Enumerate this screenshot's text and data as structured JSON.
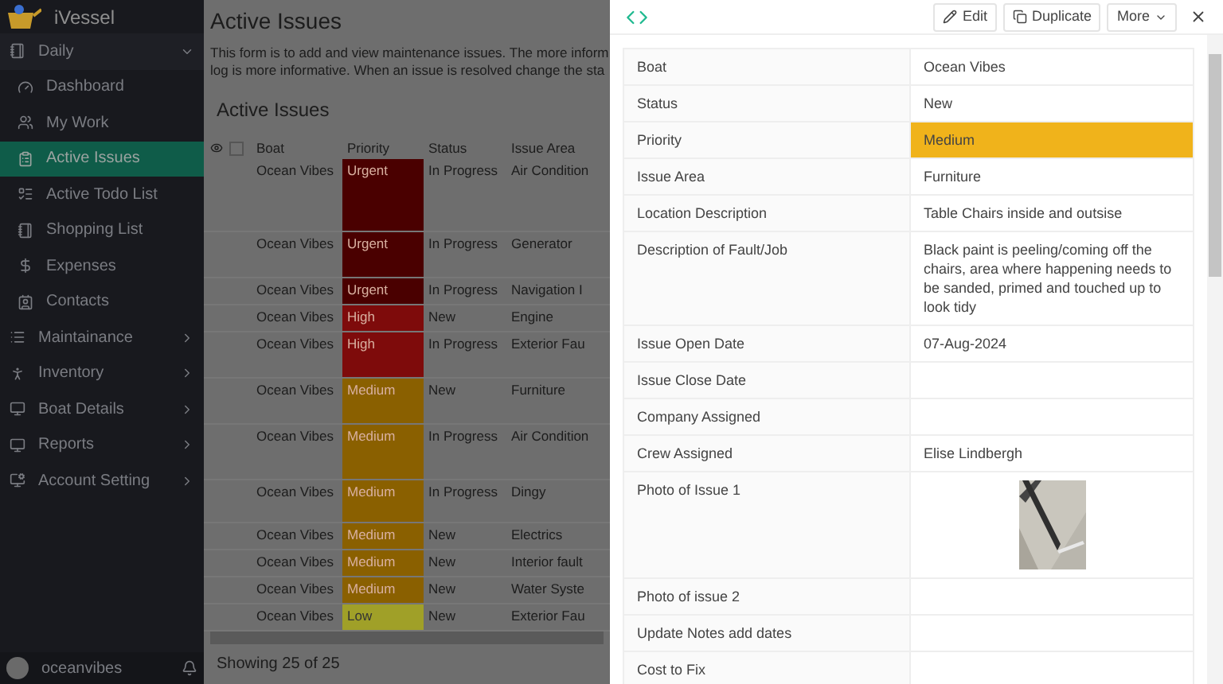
{
  "app": {
    "name": "iVessel"
  },
  "sidebar": {
    "groups": [
      {
        "label": "Daily",
        "expanded": true,
        "children": [
          {
            "label": "Dashboard",
            "selected": false
          },
          {
            "label": "My Work",
            "selected": false
          },
          {
            "label": "Active Issues",
            "selected": true
          },
          {
            "label": "Active Todo List",
            "selected": false
          },
          {
            "label": "Shopping List",
            "selected": false
          },
          {
            "label": "Expenses",
            "selected": false
          },
          {
            "label": "Contacts",
            "selected": false
          }
        ]
      },
      {
        "label": "Maintainance",
        "expanded": false
      },
      {
        "label": "Inventory",
        "expanded": false
      },
      {
        "label": "Boat Details",
        "expanded": false
      },
      {
        "label": "Reports",
        "expanded": false
      },
      {
        "label": "Account Setting",
        "expanded": false
      }
    ],
    "user": "oceanvibes"
  },
  "page": {
    "title": "Active Issues",
    "description": [
      "This form is to add and view maintenance issues. The more inform",
      "log is more informative. When an issue is resolved change the sta"
    ],
    "section_title": "Active Issues"
  },
  "table": {
    "columns": [
      "Boat",
      "Priority",
      "Status",
      "Issue Area"
    ],
    "rows": [
      {
        "boat": "Ocean Vibes",
        "priority": "Urgent",
        "color": "#4a0000",
        "status": "In Progress",
        "area": "Air Condition"
      },
      {
        "boat": "Ocean Vibes",
        "priority": "Urgent",
        "color": "#4a0000",
        "status": "In Progress",
        "area": "Generator"
      },
      {
        "boat": "Ocean Vibes",
        "priority": "Urgent",
        "color": "#4a0000",
        "status": "In Progress",
        "area": "Navigation I"
      },
      {
        "boat": "Ocean Vibes",
        "priority": "High",
        "color": "#7e0b0b",
        "status": "New",
        "area": "Engine"
      },
      {
        "boat": "Ocean Vibes",
        "priority": "High",
        "color": "#7e0b0b",
        "status": "In Progress",
        "area": "Exterior Fau"
      },
      {
        "boat": "Ocean Vibes",
        "priority": "Medium",
        "color": "#8a6000",
        "status": "New",
        "area": "Furniture"
      },
      {
        "boat": "Ocean Vibes",
        "priority": "Medium",
        "color": "#8a6000",
        "status": "In Progress",
        "area": "Air Condition"
      },
      {
        "boat": "Ocean Vibes",
        "priority": "Medium",
        "color": "#8a6000",
        "status": "In Progress",
        "area": "Dingy"
      },
      {
        "boat": "Ocean Vibes",
        "priority": "Medium",
        "color": "#8a6000",
        "status": "New",
        "area": "Electrics"
      },
      {
        "boat": "Ocean Vibes",
        "priority": "Medium",
        "color": "#8a6000",
        "status": "New",
        "area": "Interior fault"
      },
      {
        "boat": "Ocean Vibes",
        "priority": "Medium",
        "color": "#8a6000",
        "status": "New",
        "area": "Water Syste"
      },
      {
        "boat": "Ocean Vibes",
        "priority": "Low",
        "color": "#a0a028",
        "status": "New",
        "area": "Exterior Fau"
      }
    ],
    "select_all": {
      "checked": false
    },
    "footer": "Showing 25 of 25"
  },
  "drawer": {
    "buttons": [
      "Edit",
      "Duplicate",
      "More"
    ],
    "fields": [
      {
        "kind": "text",
        "label": "Boat",
        "value": "Ocean Vibes"
      },
      {
        "kind": "text",
        "label": "Status",
        "value": "New"
      },
      {
        "kind": "text",
        "label": "Priority",
        "value": "Medium",
        "color": "#f0b31b"
      },
      {
        "kind": "text",
        "label": "Issue Area",
        "value": "Furniture"
      },
      {
        "kind": "text",
        "label": "Location Description",
        "value": "Table Chairs inside and outsise"
      },
      {
        "kind": "text",
        "label": "Description of Fault/Job",
        "value": "Black paint is peeling/coming off the chairs, area where happening needs to be sanded, primed and touched up to look tidy"
      },
      {
        "kind": "text",
        "label": "Issue Open Date",
        "value": "07-Aug-2024"
      },
      {
        "kind": "text",
        "label": "Issue Close Date"
      },
      {
        "kind": "text",
        "label": "Company Assigned"
      },
      {
        "kind": "text",
        "label": "Crew Assigned",
        "value": "Elise Lindbergh"
      },
      {
        "label": "Photo of Issue 1"
      },
      {
        "kind": "text",
        "label": "Photo of issue 2"
      },
      {
        "kind": "text",
        "label": "Update Notes add dates"
      },
      {
        "kind": "text",
        "label": "Cost to Fix"
      }
    ]
  }
}
